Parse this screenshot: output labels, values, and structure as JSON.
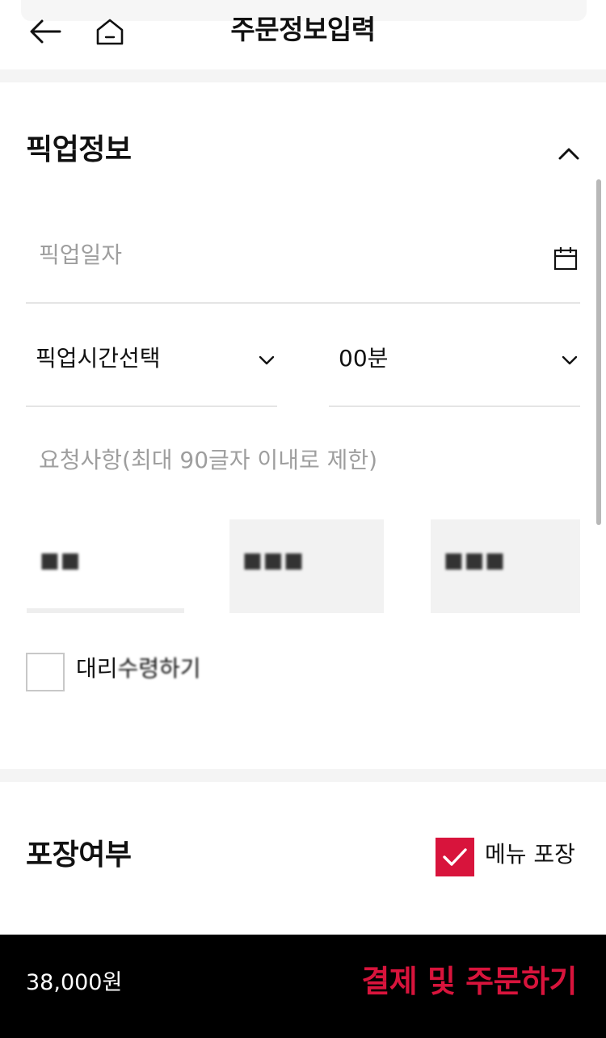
{
  "header": {
    "title": "주문정보입력",
    "back_icon": "back-arrow-icon",
    "home_icon": "home-icon"
  },
  "pickup": {
    "title": "픽업정보",
    "date_placeholder": "픽업일자",
    "time_select": "픽업시간선택",
    "minute_select": "00분",
    "request_placeholder": "요청사항(최대 90글자 이내로 제한)",
    "options": [
      "■■",
      "■■■",
      "■■■"
    ],
    "proxy_label_visible": "대리",
    "proxy_label_blurred": "수령하기"
  },
  "packaging": {
    "title": "포장여부",
    "menu_pack_label": "메뉴 포장",
    "menu_pack_checked": true
  },
  "footer": {
    "price": "38,000원",
    "order_button": "결제 및 주문하기"
  },
  "colors": {
    "accent": "#d8143c",
    "footer_bg": "#000000",
    "placeholder": "#9e9e9e"
  }
}
